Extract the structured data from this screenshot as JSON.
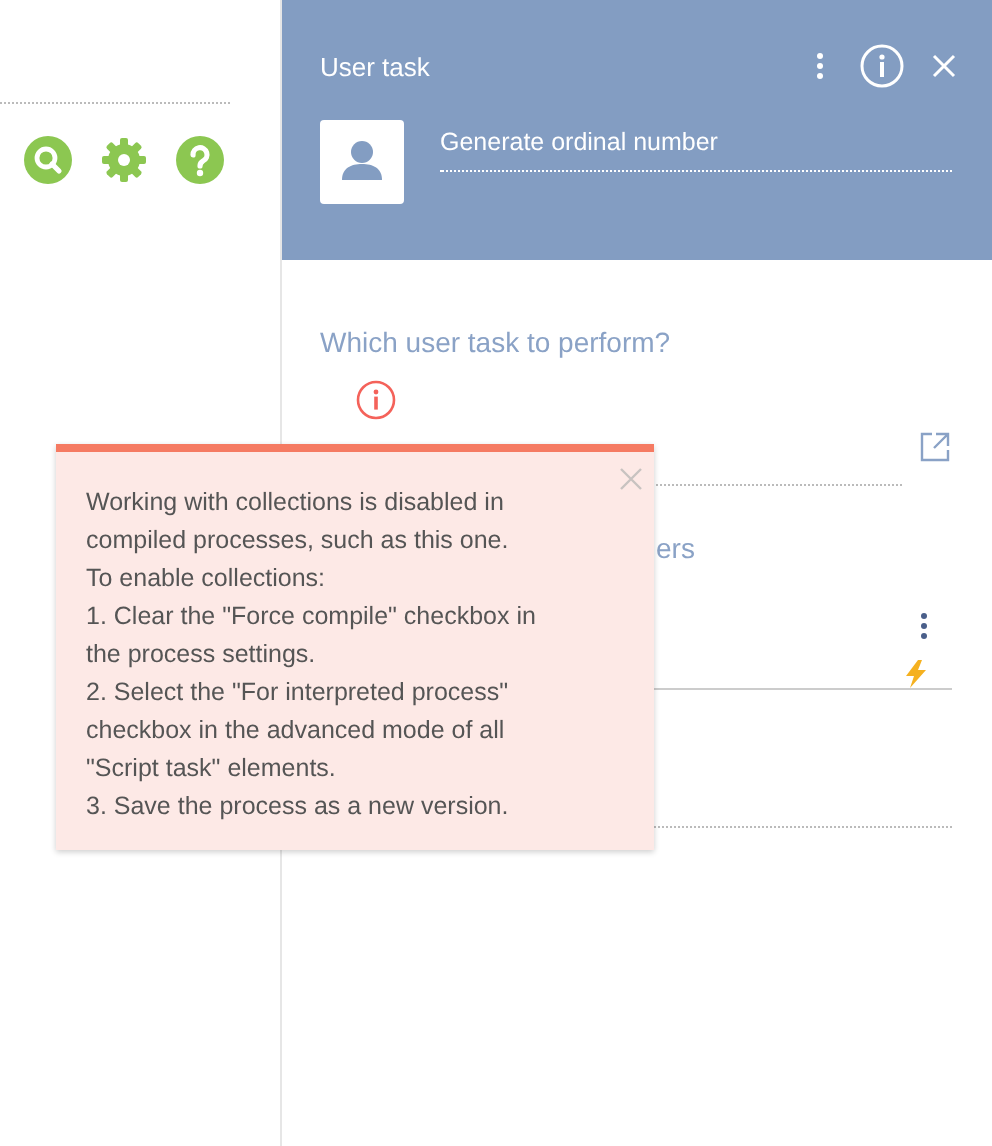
{
  "toolbar": {
    "icons": [
      {
        "kind": "search"
      },
      {
        "kind": "settings"
      },
      {
        "kind": "help"
      }
    ]
  },
  "panel": {
    "title": "User task",
    "task_name": "Generate ordinal number"
  },
  "question": "Which user task to perform?",
  "section_partial": "ers",
  "tooltip": {
    "text": "Working with collections is disabled in\ncompiled processes, such as this one.\nTo enable collections:\n1. Clear the \"Force compile\" checkbox in\nthe process settings.\n2. Select the \"For interpreted process\"\ncheckbox in the advanced mode of all\n\"Script task\" elements.\n3. Save the process as a new version."
  }
}
